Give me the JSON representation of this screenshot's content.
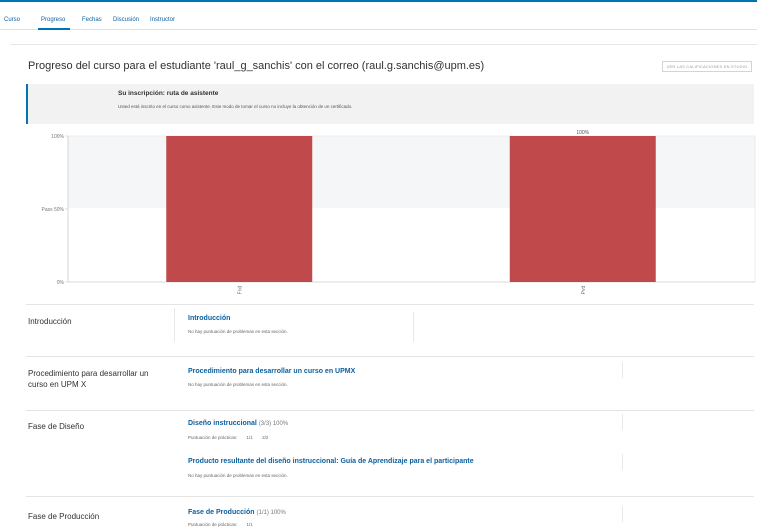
{
  "nav": {
    "tabs": [
      {
        "label": "Curso",
        "active": false
      },
      {
        "label": "Progreso",
        "active": true
      },
      {
        "label": "Fechas",
        "active": false
      },
      {
        "label": "Discusión",
        "active": false
      },
      {
        "label": "Instructor",
        "active": false
      }
    ]
  },
  "header": {
    "title": "Progreso del curso para el estudiante 'raul_g_sanchis' con el correo (raul.g.sanchis@upm.es)",
    "grades_button": "VER LAS CALIFICACIONES EN STUDIO"
  },
  "enrollment": {
    "title": "Su inscripción: ruta de asistente",
    "description": "Usted está inscrito en el curso como asistente. Este modo de tomar el curso no incluye la obtención de un certificado."
  },
  "chart_data": {
    "type": "bar",
    "categories": [
      "Fnd",
      "Pvd"
    ],
    "values": [
      100,
      100
    ],
    "data_labels": [
      "",
      "100%"
    ],
    "y_ticks": [
      {
        "label": "100%",
        "value": 100
      },
      {
        "label": "Pass 50%",
        "value": 50
      },
      {
        "label": "0%",
        "value": 0
      }
    ],
    "ylim": [
      0,
      100
    ],
    "pass_threshold": 50,
    "bar_color": "#c0494b",
    "pass_band_color": "#f4f6f8",
    "grid": false
  },
  "sections": [
    {
      "name": "Introducción",
      "subsections": [
        {
          "title": "Introducción",
          "score": "",
          "note": "No hay puntuación de problemas en esta sección.",
          "practice_label": "",
          "practice_scores": []
        }
      ]
    },
    {
      "name": "Procedimiento para desarrollar un curso en UPM X",
      "subsections": [
        {
          "title": "Procedimiento para desarrollar un curso en UPMX",
          "score": "",
          "note": "No hay puntuación de problemas en esta sección.",
          "practice_label": "",
          "practice_scores": []
        }
      ]
    },
    {
      "name": "Fase de Diseño",
      "subsections": [
        {
          "title": "Diseño instruccional",
          "score": "(3/3) 100%",
          "note": "",
          "practice_label": "Puntuación de prácticas:",
          "practice_scores": [
            "1/1",
            "2/2"
          ]
        },
        {
          "title": "Producto resultante del diseño instruccional: Guía de Aprendizaje para el participante",
          "score": "",
          "note": "No hay puntuación de problemas en esta sección.",
          "practice_label": "",
          "practice_scores": []
        }
      ]
    },
    {
      "name": "Fase de Producción",
      "subsections": [
        {
          "title": "Fase de Producción",
          "score": "(1/1) 100%",
          "note": "",
          "practice_label": "Puntuación de prácticas:",
          "practice_scores": [
            "1/1"
          ]
        }
      ]
    }
  ]
}
